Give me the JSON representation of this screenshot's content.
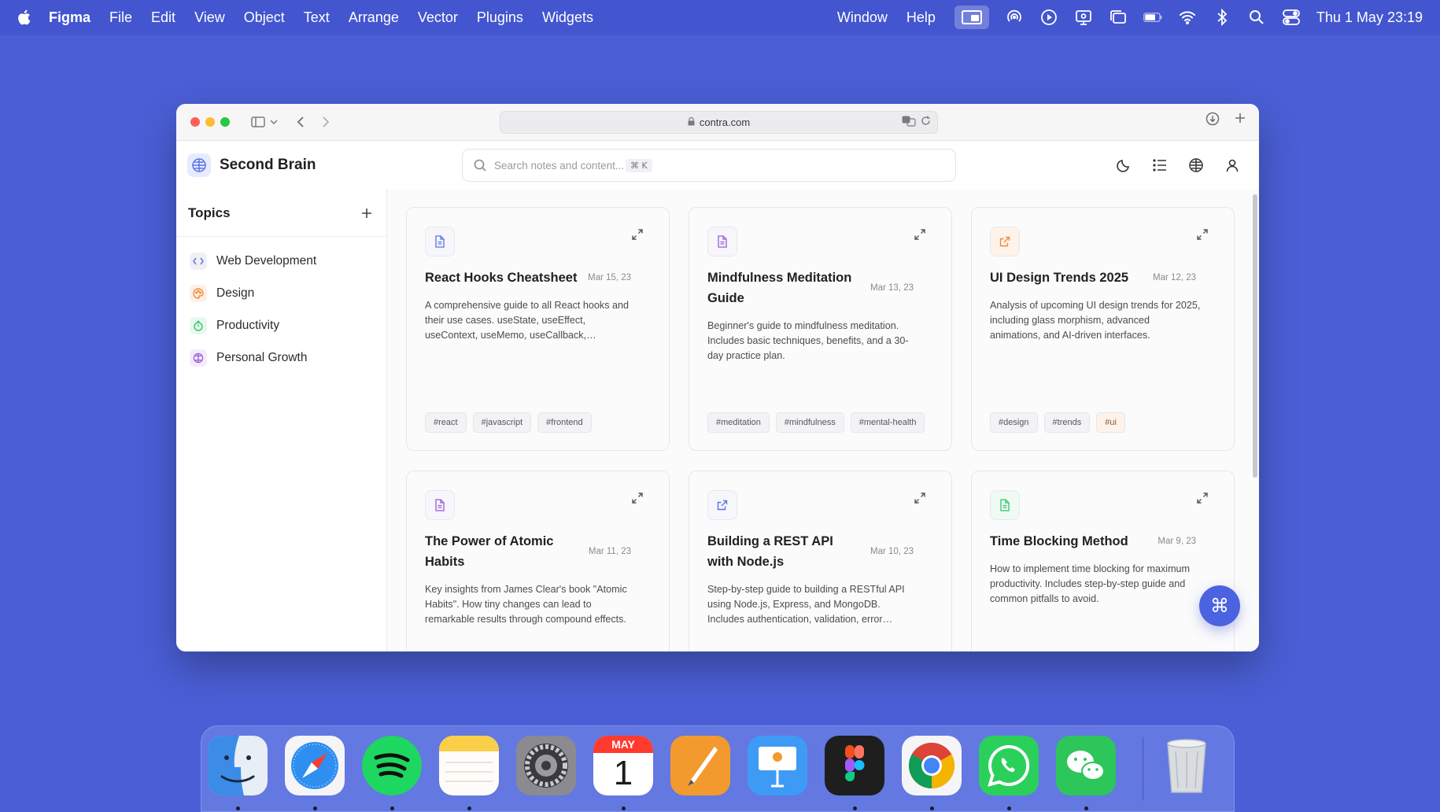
{
  "menubar": {
    "app_name": "Figma",
    "menus": [
      "File",
      "Edit",
      "View",
      "Object",
      "Text",
      "Arrange",
      "Vector",
      "Plugins",
      "Widgets"
    ],
    "right_menus": [
      "Window",
      "Help"
    ],
    "clock": "Thu 1 May  23:19"
  },
  "browser": {
    "url": "contra.com"
  },
  "app": {
    "brand": "Second Brain",
    "search_placeholder": "Search notes and content...",
    "search_shortcut": "⌘ K"
  },
  "sidebar": {
    "title": "Topics",
    "items": [
      {
        "label": "Web Development",
        "icon": "code-icon",
        "color": "#6b7280"
      },
      {
        "label": "Design",
        "icon": "palette-icon",
        "color": "#f28c38"
      },
      {
        "label": "Productivity",
        "icon": "timer-icon",
        "color": "#34c26b"
      },
      {
        "label": "Personal Growth",
        "icon": "brain-icon",
        "color": "#9b59d9"
      }
    ]
  },
  "cards": [
    {
      "title": "React Hooks Cheatsheet",
      "date": "Mar 15, 23",
      "description": "A comprehensive guide to all React hooks and their use cases. useState, useEffect, useContext, useMemo, useCallback, useReducer and custom hooks explained.",
      "tags": [
        "#react",
        "#javascript",
        "#frontend"
      ],
      "icon": "document-icon",
      "icon_color": "#5b73e8"
    },
    {
      "title": "Mindfulness Meditation Guide",
      "date": "Mar 13, 23",
      "description": "Beginner's guide to mindfulness meditation. Includes basic techniques, benefits, and a 30-day practice plan.",
      "tags": [
        "#meditation",
        "#mindfulness",
        "#mental-health"
      ],
      "icon": "document-icon",
      "icon_color": "#9b59d9"
    },
    {
      "title": "UI Design Trends 2025",
      "date": "Mar 12, 23",
      "description": "Analysis of upcoming UI design trends for 2025, including glass morphism, advanced animations, and AI-driven interfaces.",
      "tags": [
        "#design",
        "#trends",
        "#ui"
      ],
      "icon": "external-link-icon",
      "icon_color": "#f28c38"
    },
    {
      "title": "The Power of Atomic Habits",
      "date": "Mar 11, 23",
      "description": "Key insights from James Clear's book \"Atomic Habits\". How tiny changes can lead to remarkable results through compound effects.",
      "tags": [],
      "icon": "document-icon",
      "icon_color": "#9b59d9"
    },
    {
      "title": "Building a REST API with Node.js",
      "date": "Mar 10, 23",
      "description": "Step-by-step guide to building a RESTful API using Node.js, Express, and MongoDB. Includes authentication, validation, error handling.",
      "tags": [],
      "icon": "external-link-icon",
      "icon_color": "#5b73e8"
    },
    {
      "title": "Time Blocking Method",
      "date": "Mar 9, 23",
      "description": "How to implement time blocking for maximum productivity. Includes step-by-step guide and common pitfalls to avoid.",
      "tags": [],
      "icon": "document-icon",
      "icon_color": "#34c26b"
    }
  ],
  "dock": {
    "apps": [
      "finder",
      "safari",
      "spotify",
      "notes",
      "system-settings",
      "calendar",
      "pages",
      "keynote",
      "figma",
      "chrome",
      "whatsapp",
      "wechat",
      "trash"
    ],
    "calendar_month": "MAY",
    "calendar_day": "1"
  }
}
